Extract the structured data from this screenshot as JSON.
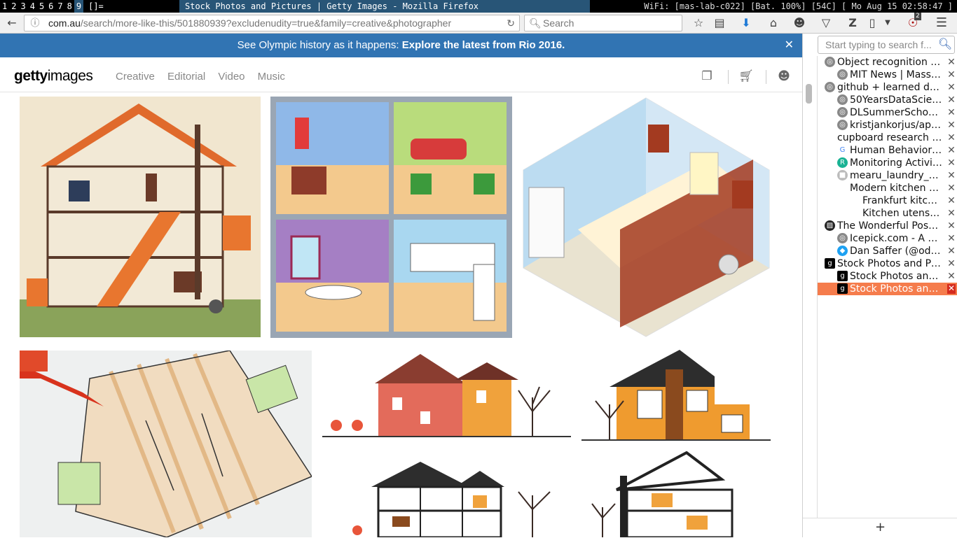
{
  "wm": {
    "workspaces": [
      "1",
      "2",
      "3",
      "4",
      "5",
      "6",
      "7",
      "8",
      "9"
    ],
    "layout": "[]=",
    "window_title": "Stock Photos and Pictures | Getty Images - Mozilla Firefox",
    "status": "WiFi: [mas-lab-c022]  [Bat. 100%] [54C] [ Mo Aug 15 02:58:47 ]"
  },
  "browser": {
    "url_host": "com.au",
    "url_path": "/search/more-like-this/501880939?excludenudity=true&family=creative&photographer",
    "search_placeholder": "Search",
    "icons": [
      "back-icon",
      "info-icon",
      "reload-icon",
      "search-icon",
      "star-icon",
      "reader-icon",
      "download-icon",
      "home-icon",
      "chat-icon",
      "pocket-icon",
      "zotero-icon",
      "page-icon",
      "ublock-icon",
      "menu-icon"
    ],
    "ublock_count": "2"
  },
  "page": {
    "banner_prefix": "See Olympic history as it happens: ",
    "banner_link": "Explore the latest from Rio 2016.",
    "logo_bold": "getty",
    "logo_rest": "images",
    "nav": [
      "Creative",
      "Editorial",
      "Video",
      "Music"
    ]
  },
  "sidebar": {
    "filter_placeholder": "Start typing to search f...",
    "tabs": [
      {
        "title": "Object recognition fo...",
        "depth": 0,
        "fav": "globe-icon"
      },
      {
        "title": "MIT News | Massa...",
        "depth": 1,
        "fav": "globe-icon"
      },
      {
        "title": "github + learned dee...",
        "depth": 0,
        "fav": "globe-icon"
      },
      {
        "title": "50YearsDataScien...",
        "depth": 1,
        "fav": "globe-icon"
      },
      {
        "title": "DLSummerSchool...",
        "depth": 1,
        "fav": "globe-icon"
      },
      {
        "title": "kristjankorjus/app...",
        "depth": 1,
        "fav": "globe-icon"
      },
      {
        "title": "cupboard research - ...",
        "depth": 0,
        "fav": ""
      },
      {
        "title": "Human Behavior ...",
        "depth": 1,
        "fav": "google-icon"
      },
      {
        "title": "Monitoring Activit...",
        "depth": 1,
        "fav": "researchgate-icon"
      },
      {
        "title": "mearu_laundry_d...",
        "depth": 1,
        "fav": "gsir-icon"
      },
      {
        "title": "Modern kitchen g...",
        "depth": 1,
        "fav": ""
      },
      {
        "title": "Frankfurt kitch...",
        "depth": 2,
        "fav": ""
      },
      {
        "title": "Kitchen utensil ...",
        "depth": 2,
        "fav": ""
      },
      {
        "title": "The Wonderful Possi...",
        "depth": 0,
        "fav": "photo-icon"
      },
      {
        "title": "Icepick.com - A 1...",
        "depth": 1,
        "fav": "globe-icon"
      },
      {
        "title": "Dan Saffer (@oda...",
        "depth": 1,
        "fav": "twitter-icon"
      },
      {
        "title": "Stock Photos and Pic...",
        "depth": 0,
        "fav": "getty-icon"
      },
      {
        "title": "Stock Photos and ...",
        "depth": 1,
        "fav": "getty-icon"
      },
      {
        "title": "Stock Photos and ...",
        "depth": 1,
        "fav": "getty-icon",
        "selected": true
      }
    ],
    "footer": "+"
  }
}
